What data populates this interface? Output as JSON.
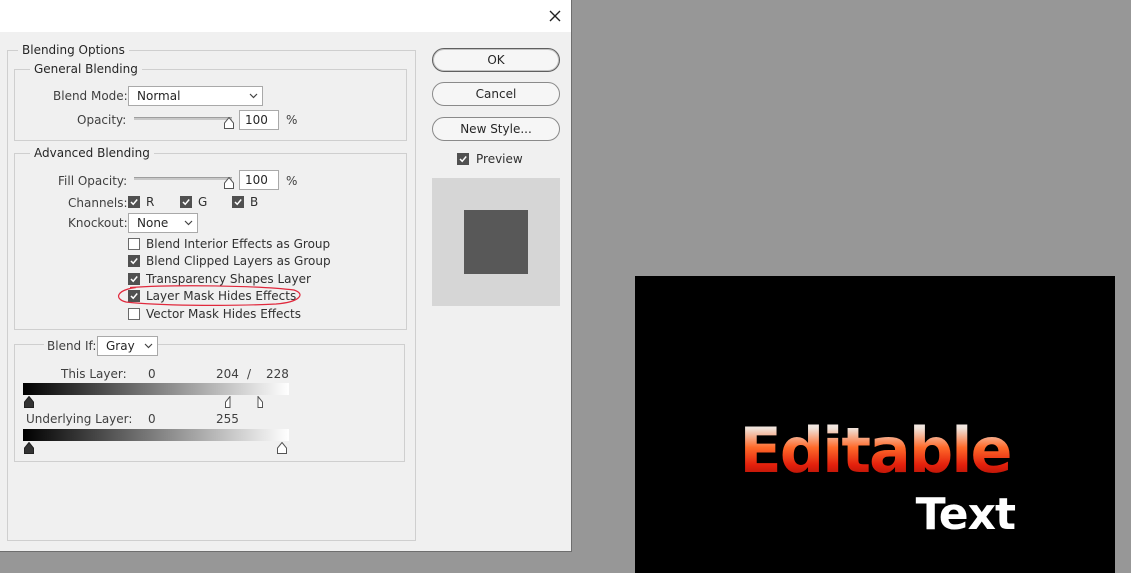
{
  "dialog": {
    "section_title": "Blending Options",
    "general": {
      "title": "General Blending",
      "blend_mode_label": "Blend Mode:",
      "blend_mode_value": "Normal",
      "opacity_label": "Opacity:",
      "opacity_value": "100",
      "opacity_unit": "%",
      "opacity_level": 1.0
    },
    "advanced": {
      "title": "Advanced Blending",
      "fill_opacity_label": "Fill Opacity:",
      "fill_opacity_value": "100",
      "fill_opacity_unit": "%",
      "fill_opacity_level": 1.0,
      "channels_label": "Channels:",
      "channels": [
        {
          "label": "R",
          "checked": true
        },
        {
          "label": "G",
          "checked": true
        },
        {
          "label": "B",
          "checked": true
        }
      ],
      "knockout_label": "Knockout:",
      "knockout_value": "None",
      "options": [
        {
          "label": "Blend Interior Effects as Group",
          "checked": false
        },
        {
          "label": "Blend Clipped Layers as Group",
          "checked": true
        },
        {
          "label": "Transparency Shapes Layer",
          "checked": true
        },
        {
          "label": "Layer Mask Hides Effects",
          "checked": true,
          "highlighted": true
        },
        {
          "label": "Vector Mask Hides Effects",
          "checked": false
        }
      ]
    },
    "blend_if": {
      "label": "Blend If:",
      "value": "Gray",
      "this_layer_label": "This Layer:",
      "this_layer_low": "0",
      "this_layer_high_a": "204",
      "this_layer_sep": "/",
      "this_layer_high_b": "228",
      "underlying_label": "Underlying Layer:",
      "underlying_low": "0",
      "underlying_high": "255"
    },
    "buttons": {
      "ok": "OK",
      "cancel": "Cancel",
      "new_style": "New Style..."
    },
    "preview_label": "Preview",
    "preview_checked": true,
    "colors": {
      "highlight": "#e0283c",
      "swatch": "#585858"
    }
  },
  "canvas": {
    "line1": "Editable",
    "line2": "Text"
  }
}
